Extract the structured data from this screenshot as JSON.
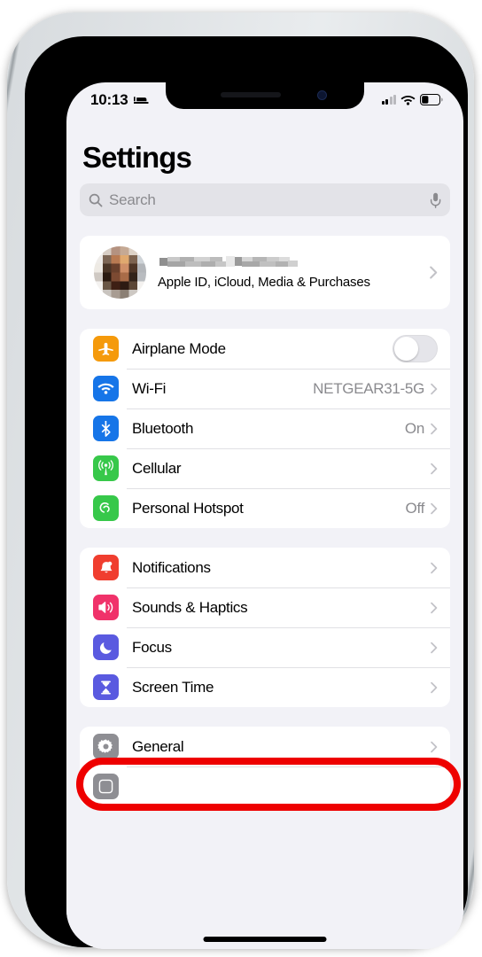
{
  "device": {
    "name": "iphone-frame",
    "frame_color": "#e9ecee"
  },
  "status_bar": {
    "time": "10:13",
    "sleep_icon": "bed-icon",
    "signal_icon": "cellular-bars-icon",
    "signal_bars_filled": 2,
    "signal_bars_total": 4,
    "wifi_icon": "wifi-icon",
    "battery_icon": "battery-icon",
    "battery_level_pct": 35
  },
  "header": {
    "title": "Settings"
  },
  "search": {
    "placeholder": "Search",
    "search_icon": "search-icon",
    "mic_icon": "microphone-icon"
  },
  "apple_id": {
    "name_redacted": true,
    "subtitle": "Apple ID, iCloud, Media & Purchases",
    "avatar_icon": "avatar",
    "chevron_icon": "chevron-right-icon"
  },
  "groups": [
    {
      "id": "connectivity",
      "rows": [
        {
          "label": "Airplane Mode",
          "icon": "airplane-icon",
          "icon_color": "#f59a0b",
          "accessory": "toggle",
          "toggle_on": false,
          "value": ""
        },
        {
          "label": "Wi-Fi",
          "icon": "wifi-icon",
          "icon_color": "#1675e8",
          "accessory": "chevron",
          "value": "NETGEAR31-5G"
        },
        {
          "label": "Bluetooth",
          "icon": "bluetooth-icon",
          "icon_color": "#1675e8",
          "accessory": "chevron",
          "value": "On"
        },
        {
          "label": "Cellular",
          "icon": "cellular-antenna-icon",
          "icon_color": "#37c84a",
          "accessory": "chevron",
          "value": ""
        },
        {
          "label": "Personal Hotspot",
          "icon": "hotspot-link-icon",
          "icon_color": "#37c84a",
          "accessory": "chevron",
          "value": "Off"
        }
      ]
    },
    {
      "id": "notifications",
      "rows": [
        {
          "label": "Notifications",
          "icon": "bell-icon",
          "icon_color": "#f03e2f",
          "accessory": "chevron",
          "value": ""
        },
        {
          "label": "Sounds & Haptics",
          "icon": "speaker-icon",
          "icon_color": "#f0326a",
          "accessory": "chevron",
          "value": ""
        },
        {
          "label": "Focus",
          "icon": "moon-icon",
          "icon_color": "#5a5ae0",
          "accessory": "chevron",
          "value": "",
          "highlighted": true
        },
        {
          "label": "Screen Time",
          "icon": "hourglass-icon",
          "icon_color": "#5a5ae0",
          "accessory": "chevron",
          "value": ""
        }
      ]
    },
    {
      "id": "system",
      "rows": [
        {
          "label": "General",
          "icon": "gear-icon",
          "icon_color": "#8e8e93",
          "accessory": "chevron",
          "value": ""
        }
      ]
    }
  ],
  "annotation": {
    "type": "red-oval-highlight",
    "target": "Focus",
    "color": "#ee0000"
  },
  "home_indicator": {
    "icon": "home-indicator-bar"
  }
}
